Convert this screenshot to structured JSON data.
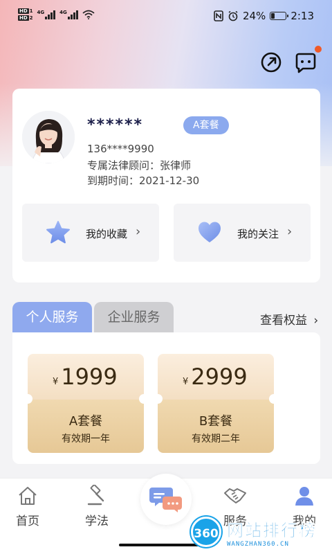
{
  "status_bar": {
    "hd1": "HD",
    "hd1_sim": "1",
    "hd2": "HD",
    "hd2_sim": "2",
    "net1": "4G",
    "net2": "4G",
    "battery_text": "24%",
    "battery_level": 0.24,
    "time": "2:13"
  },
  "header": {
    "share_icon": "share-out-icon",
    "message_icon": "message-icon",
    "has_notification": true
  },
  "profile": {
    "nickname": "******",
    "plan_badge": "A套餐",
    "phone": "136****9990",
    "advisor": "专属法律顾问：张律师",
    "expiry": "到期时间：2021-12-30",
    "quick_links": [
      {
        "label": "我的收藏",
        "icon": "star-icon"
      },
      {
        "label": "我的关注",
        "icon": "heart-icon"
      }
    ]
  },
  "services": {
    "tabs": [
      {
        "label": "个人服务",
        "active": true
      },
      {
        "label": "企业服务",
        "active": false
      }
    ],
    "view_benefits": "查看权益",
    "packages": [
      {
        "currency": "¥",
        "price": "1999",
        "name": "A套餐",
        "validity": "有效期一年"
      },
      {
        "currency": "¥",
        "price": "2999",
        "name": "B套餐",
        "validity": "有效期二年"
      }
    ]
  },
  "bottom_nav": {
    "items": [
      {
        "label": "首页",
        "icon": "home-icon"
      },
      {
        "label": "学法",
        "icon": "gavel-icon"
      },
      {
        "label": "",
        "icon": "chat-bubbles-icon"
      },
      {
        "label": "服务",
        "icon": "handshake-icon"
      },
      {
        "label": "我的",
        "icon": "person-icon",
        "active": true
      }
    ]
  },
  "watermark": {
    "badge": "360",
    "title": "网站排行榜",
    "subtitle": "WANGZHAN360.CN"
  },
  "colors": {
    "accent_blue": "#8fa9ee",
    "gold_light": "#fbeede",
    "gold_dark": "#e6c896",
    "notification": "#f05a28"
  }
}
